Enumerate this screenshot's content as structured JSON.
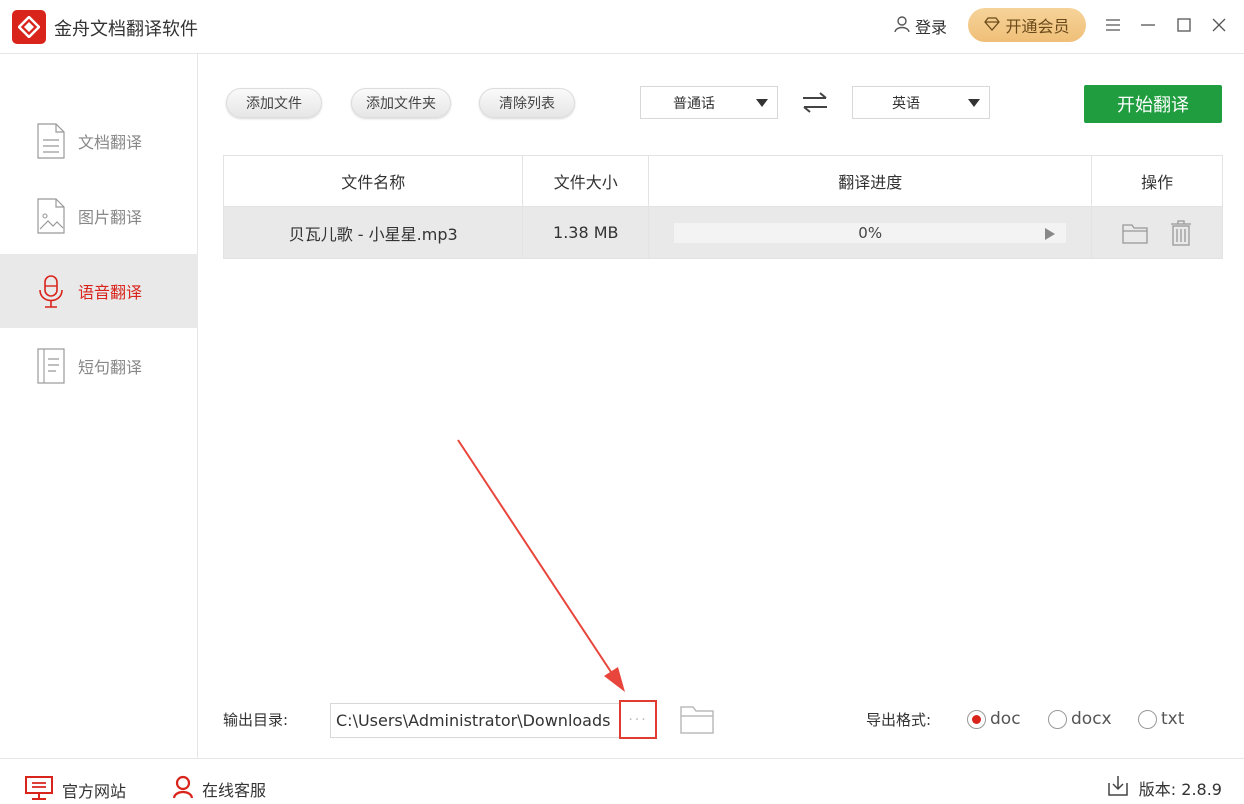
{
  "app": {
    "title": "金舟文档翻译软件",
    "brand_color": "#d9241c"
  },
  "header": {
    "login_label": "登录",
    "vip_label": "开通会员",
    "menu_icon": "menu-icon",
    "minimize_icon": "minimize-icon",
    "maximize_icon": "maximize-icon",
    "close_icon": "close-icon"
  },
  "sidebar": {
    "items": [
      {
        "label": "文档翻译",
        "icon": "document-icon",
        "active": false
      },
      {
        "label": "图片翻译",
        "icon": "image-icon",
        "active": false
      },
      {
        "label": "语音翻译",
        "icon": "microphone-icon",
        "active": true
      },
      {
        "label": "短句翻译",
        "icon": "text-icon",
        "active": false
      }
    ]
  },
  "toolbar": {
    "add_file": "添加文件",
    "add_folder": "添加文件夹",
    "clear_list": "清除列表",
    "source_lang": "普通话",
    "target_lang": "英语",
    "start": "开始翻译",
    "start_color": "#1f9d3f"
  },
  "table": {
    "headers": [
      "文件名称",
      "文件大小",
      "翻译进度",
      "操作"
    ],
    "rows": [
      {
        "name": "贝瓦儿歌 - 小星星.mp3",
        "size": "1.38 MB",
        "progress_text": "0%",
        "progress": 0
      }
    ]
  },
  "output": {
    "label": "输出目录:",
    "path": "C:\\Users\\Administrator\\Downloads",
    "browse_label": "···"
  },
  "format": {
    "label": "导出格式:",
    "options": [
      "doc",
      "docx",
      "txt"
    ],
    "selected": "doc"
  },
  "footer": {
    "website": "官方网站",
    "support": "在线客服",
    "version": "版本: 2.8.9"
  }
}
